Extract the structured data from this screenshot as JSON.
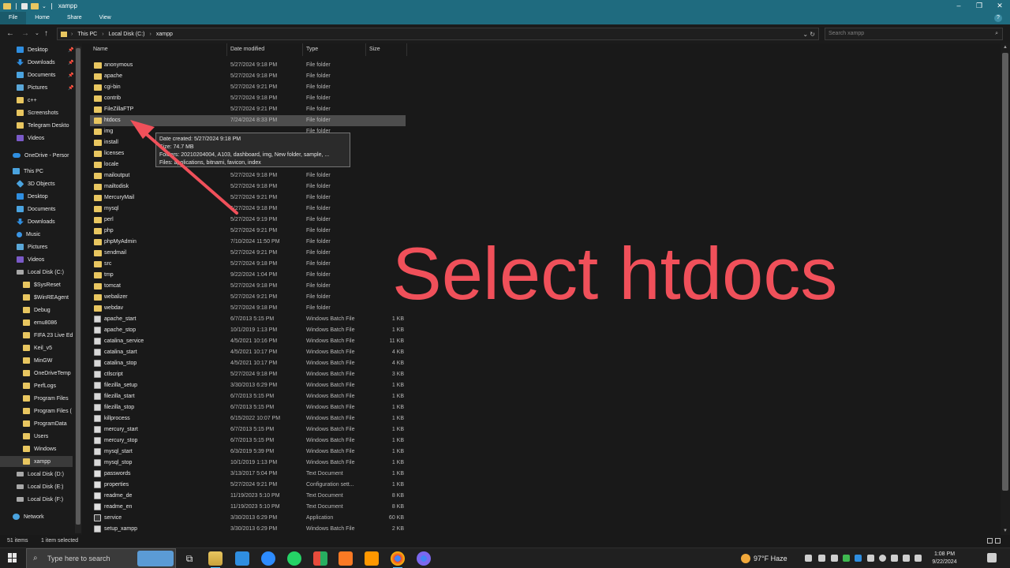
{
  "window": {
    "title": "xampp"
  },
  "ribbon": {
    "tabs": [
      "File",
      "Home",
      "Share",
      "View"
    ]
  },
  "address": {
    "crumbs": [
      "This PC",
      "Local Disk (C:)",
      "xampp"
    ],
    "search_placeholder": "Search xampp"
  },
  "nav": {
    "items": [
      {
        "label": "Desktop",
        "icon": "desktop-icon",
        "pinned": true
      },
      {
        "label": "Downloads",
        "icon": "download-icon",
        "pinned": true
      },
      {
        "label": "Documents",
        "icon": "documents-icon",
        "pinned": true
      },
      {
        "label": "Pictures",
        "icon": "pictures-icon",
        "pinned": true
      },
      {
        "label": "c++",
        "icon": "folder-icon"
      },
      {
        "label": "Screenshots",
        "icon": "folder-icon"
      },
      {
        "label": "Telegram Deskto",
        "icon": "folder-icon"
      },
      {
        "label": "Videos",
        "icon": "videos-icon"
      },
      {
        "label": "OneDrive - Persor",
        "icon": "onedrive-icon"
      },
      {
        "label": "This PC",
        "icon": "this-pc-icon"
      },
      {
        "label": "3D Objects",
        "icon": "3d-objects-icon"
      },
      {
        "label": "Desktop",
        "icon": "desktop-icon"
      },
      {
        "label": "Documents",
        "icon": "documents-icon"
      },
      {
        "label": "Downloads",
        "icon": "download-icon"
      },
      {
        "label": "Music",
        "icon": "music-icon"
      },
      {
        "label": "Pictures",
        "icon": "pictures-icon"
      },
      {
        "label": "Videos",
        "icon": "videos-icon"
      },
      {
        "label": "Local Disk (C:)",
        "icon": "drive-icon"
      },
      {
        "label": "$SysReset",
        "icon": "folder-icon"
      },
      {
        "label": "$WinREAgent",
        "icon": "folder-icon"
      },
      {
        "label": "Debug",
        "icon": "folder-icon"
      },
      {
        "label": "emu8086",
        "icon": "folder-icon"
      },
      {
        "label": "FIFA 23 Live Ed",
        "icon": "folder-icon"
      },
      {
        "label": "Keil_v5",
        "icon": "folder-icon"
      },
      {
        "label": "MinGW",
        "icon": "folder-icon"
      },
      {
        "label": "OneDriveTemp",
        "icon": "folder-icon"
      },
      {
        "label": "PerfLogs",
        "icon": "folder-icon"
      },
      {
        "label": "Program Files",
        "icon": "folder-icon"
      },
      {
        "label": "Program Files (",
        "icon": "folder-icon"
      },
      {
        "label": "ProgramData",
        "icon": "folder-icon"
      },
      {
        "label": "Users",
        "icon": "folder-icon"
      },
      {
        "label": "Windows",
        "icon": "folder-icon"
      },
      {
        "label": "xampp",
        "icon": "folder-icon",
        "selected": true
      },
      {
        "label": "Local Disk (D:)",
        "icon": "drive-icon"
      },
      {
        "label": "Local Disk (E:)",
        "icon": "drive-icon"
      },
      {
        "label": "Local Disk (F:)",
        "icon": "drive-icon"
      },
      {
        "label": "Network",
        "icon": "network-icon"
      }
    ]
  },
  "columns": {
    "name": "Name",
    "date": "Date modified",
    "type": "Type",
    "size": "Size"
  },
  "files": [
    {
      "name": "anonymous",
      "date": "5/27/2024 9:18 PM",
      "type": "File folder",
      "size": "",
      "kind": "folder"
    },
    {
      "name": "apache",
      "date": "5/27/2024 9:18 PM",
      "type": "File folder",
      "size": "",
      "kind": "folder"
    },
    {
      "name": "cgi-bin",
      "date": "5/27/2024 9:21 PM",
      "type": "File folder",
      "size": "",
      "kind": "folder"
    },
    {
      "name": "contrib",
      "date": "5/27/2024 9:18 PM",
      "type": "File folder",
      "size": "",
      "kind": "folder"
    },
    {
      "name": "FileZillaFTP",
      "date": "5/27/2024 9:21 PM",
      "type": "File folder",
      "size": "",
      "kind": "folder"
    },
    {
      "name": "htdocs",
      "date": "7/24/2024 8:33 PM",
      "type": "File folder",
      "size": "",
      "kind": "folder",
      "selected": true
    },
    {
      "name": "img",
      "date": "",
      "type": "File folder",
      "size": "",
      "kind": "folder"
    },
    {
      "name": "install",
      "date": "",
      "type": "",
      "size": "",
      "kind": "folder"
    },
    {
      "name": "licenses",
      "date": "",
      "type": "",
      "size": "",
      "kind": "folder"
    },
    {
      "name": "locale",
      "date": "",
      "type": "",
      "size": "",
      "kind": "folder"
    },
    {
      "name": "mailoutput",
      "date": "5/27/2024 9:18 PM",
      "type": "File folder",
      "size": "",
      "kind": "folder"
    },
    {
      "name": "mailtodisk",
      "date": "5/27/2024 9:18 PM",
      "type": "File folder",
      "size": "",
      "kind": "folder"
    },
    {
      "name": "MercuryMail",
      "date": "5/27/2024 9:21 PM",
      "type": "File folder",
      "size": "",
      "kind": "folder"
    },
    {
      "name": "mysql",
      "date": "5/27/2024 9:18 PM",
      "type": "File folder",
      "size": "",
      "kind": "folder"
    },
    {
      "name": "perl",
      "date": "5/27/2024 9:19 PM",
      "type": "File folder",
      "size": "",
      "kind": "folder"
    },
    {
      "name": "php",
      "date": "5/27/2024 9:21 PM",
      "type": "File folder",
      "size": "",
      "kind": "folder"
    },
    {
      "name": "phpMyAdmin",
      "date": "7/10/2024 11:50 PM",
      "type": "File folder",
      "size": "",
      "kind": "folder"
    },
    {
      "name": "sendmail",
      "date": "5/27/2024 9:21 PM",
      "type": "File folder",
      "size": "",
      "kind": "folder"
    },
    {
      "name": "src",
      "date": "5/27/2024 9:18 PM",
      "type": "File folder",
      "size": "",
      "kind": "folder"
    },
    {
      "name": "tmp",
      "date": "9/22/2024 1:04 PM",
      "type": "File folder",
      "size": "",
      "kind": "folder"
    },
    {
      "name": "tomcat",
      "date": "5/27/2024 9:18 PM",
      "type": "File folder",
      "size": "",
      "kind": "folder"
    },
    {
      "name": "webalizer",
      "date": "5/27/2024 9:21 PM",
      "type": "File folder",
      "size": "",
      "kind": "folder"
    },
    {
      "name": "webdav",
      "date": "5/27/2024 9:18 PM",
      "type": "File folder",
      "size": "",
      "kind": "folder"
    },
    {
      "name": "apache_start",
      "date": "6/7/2013 5:15 PM",
      "type": "Windows Batch File",
      "size": "1 KB",
      "kind": "bat"
    },
    {
      "name": "apache_stop",
      "date": "10/1/2019 1:13 PM",
      "type": "Windows Batch File",
      "size": "1 KB",
      "kind": "bat"
    },
    {
      "name": "catalina_service",
      "date": "4/5/2021 10:16 PM",
      "type": "Windows Batch File",
      "size": "11 KB",
      "kind": "bat"
    },
    {
      "name": "catalina_start",
      "date": "4/5/2021 10:17 PM",
      "type": "Windows Batch File",
      "size": "4 KB",
      "kind": "bat"
    },
    {
      "name": "catalina_stop",
      "date": "4/5/2021 10:17 PM",
      "type": "Windows Batch File",
      "size": "4 KB",
      "kind": "bat"
    },
    {
      "name": "ctlscript",
      "date": "5/27/2024 9:18 PM",
      "type": "Windows Batch File",
      "size": "3 KB",
      "kind": "bat"
    },
    {
      "name": "filezilla_setup",
      "date": "3/30/2013 6:29 PM",
      "type": "Windows Batch File",
      "size": "1 KB",
      "kind": "bat"
    },
    {
      "name": "filezilla_start",
      "date": "6/7/2013 5:15 PM",
      "type": "Windows Batch File",
      "size": "1 KB",
      "kind": "bat"
    },
    {
      "name": "filezilla_stop",
      "date": "6/7/2013 5:15 PM",
      "type": "Windows Batch File",
      "size": "1 KB",
      "kind": "bat"
    },
    {
      "name": "killprocess",
      "date": "6/15/2022 10:07 PM",
      "type": "Windows Batch File",
      "size": "1 KB",
      "kind": "bat"
    },
    {
      "name": "mercury_start",
      "date": "6/7/2013 5:15 PM",
      "type": "Windows Batch File",
      "size": "1 KB",
      "kind": "bat"
    },
    {
      "name": "mercury_stop",
      "date": "6/7/2013 5:15 PM",
      "type": "Windows Batch File",
      "size": "1 KB",
      "kind": "bat"
    },
    {
      "name": "mysql_start",
      "date": "6/3/2019 5:39 PM",
      "type": "Windows Batch File",
      "size": "1 KB",
      "kind": "bat"
    },
    {
      "name": "mysql_stop",
      "date": "10/1/2019 1:13 PM",
      "type": "Windows Batch File",
      "size": "1 KB",
      "kind": "bat"
    },
    {
      "name": "passwords",
      "date": "3/13/2017 5:04 PM",
      "type": "Text Document",
      "size": "1 KB",
      "kind": "txt"
    },
    {
      "name": "properties",
      "date": "5/27/2024 9:21 PM",
      "type": "Configuration sett...",
      "size": "1 KB",
      "kind": "txt"
    },
    {
      "name": "readme_de",
      "date": "11/19/2023 5:10 PM",
      "type": "Text Document",
      "size": "8 KB",
      "kind": "txt"
    },
    {
      "name": "readme_en",
      "date": "11/19/2023 5:10 PM",
      "type": "Text Document",
      "size": "8 KB",
      "kind": "txt"
    },
    {
      "name": "service",
      "date": "3/30/2013 6:29 PM",
      "type": "Application",
      "size": "60 KB",
      "kind": "app"
    },
    {
      "name": "setup_xampp",
      "date": "3/30/2013 6:29 PM",
      "type": "Windows Batch File",
      "size": "2 KB",
      "kind": "bat"
    }
  ],
  "tooltip": {
    "line1": "Date created: 5/27/2024 9:18 PM",
    "line2": "Size: 74.7 MB",
    "line3": "Folders: 20210204004, A103, dashboard, img, New folder, sample, ...",
    "line4": "Files: applications, bitnami, favicon, index"
  },
  "annotation": {
    "text": "Select htdocs",
    "color": "#f0505a"
  },
  "status": {
    "count": "51 items",
    "selection": "1 item selected"
  },
  "taskbar": {
    "search_placeholder": "Type here to search",
    "weather": "97°F  Haze",
    "time": "1:08 PM",
    "date": "9/22/2024",
    "apps": [
      "task-view-icon",
      "file-explorer-icon",
      "vscode-icon",
      "zoom-icon",
      "whatsapp-icon",
      "office-icon",
      "xampp-icon",
      "sublime-icon",
      "chrome-icon",
      "chrome-dev-icon"
    ]
  }
}
